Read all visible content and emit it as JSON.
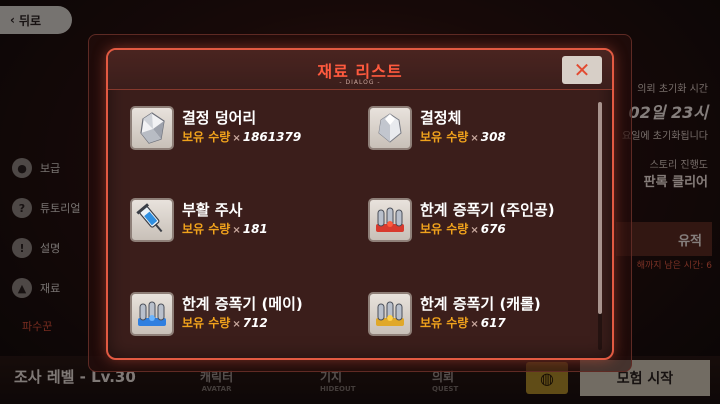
{
  "background": {
    "back_label": "뒤로",
    "side_menu": [
      {
        "label": "보급",
        "icon": "supply-icon",
        "glyph": "●"
      },
      {
        "label": "튜토리얼",
        "icon": "help-icon",
        "glyph": "?"
      },
      {
        "label": "설명",
        "icon": "info-icon",
        "glyph": "!"
      },
      {
        "label": "재료",
        "icon": "material-icon",
        "glyph": "▲"
      }
    ],
    "side_tab": "파수꾼",
    "right_panel": {
      "reset_label": "의뢰 초기화 시간",
      "timer": "02일 23시",
      "reset_note": "요일에 초기화됩니다",
      "story_label": "스토리 진행도",
      "story_value": "판록 클리어",
      "ruins_label": "유적",
      "ruins_time": "해까지 남은 시간: 6"
    },
    "level_text": "조사 레벨 - Lv.30",
    "nav": [
      {
        "label": "캐릭터",
        "sub": "AVATAR"
      },
      {
        "label": "기지",
        "sub": "HIDEOUT"
      },
      {
        "label": "의뢰",
        "sub": "QUEST"
      }
    ],
    "start_button": "모험 시작"
  },
  "dialog": {
    "title": "재료 리스트",
    "subtitle": "- DIALOG -",
    "close_glyph": "✕",
    "qty_label": "보유 수량",
    "qty_x": "×",
    "items": [
      {
        "name": "결정 덩어리",
        "qty": "1861379",
        "icon": "crystal-chunk-icon"
      },
      {
        "name": "결정체",
        "qty": "308",
        "icon": "crystal-icon"
      },
      {
        "name": "부활 주사",
        "qty": "181",
        "icon": "revive-syringe-icon"
      },
      {
        "name": "한계 증폭기 (주인공)",
        "qty": "676",
        "icon": "amplifier-protagonist-icon"
      },
      {
        "name": "한계 증폭기 (메이)",
        "qty": "712",
        "icon": "amplifier-mei-icon"
      },
      {
        "name": "한계 증폭기 (캐롤)",
        "qty": "617",
        "icon": "amplifier-carol-icon"
      }
    ]
  },
  "colors": {
    "accent": "#e25a42",
    "title": "#ff5a3e",
    "qty_label": "#f0a21c",
    "dialog_bg": "#3b1e1b"
  }
}
